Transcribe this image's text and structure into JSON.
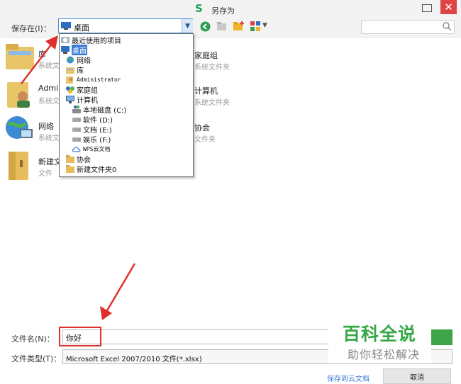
{
  "title": {
    "logo": "S",
    "text": "另存为"
  },
  "toolbar": {
    "save_in_label": "保存在(I)：",
    "location_value": "桌面"
  },
  "files": [
    {
      "name": "库",
      "type": "系统文件夹",
      "icon": "library-folder-icon"
    },
    {
      "name": "家庭组",
      "type": "系统文件夹",
      "icon": "homegroup-icon"
    },
    {
      "name": "Admi",
      "type": "系统文",
      "icon": "user-folder-icon"
    },
    {
      "name": "计算机",
      "type": "系统文件夹",
      "icon": "computer-icon"
    },
    {
      "name": "网络",
      "type": "系统文",
      "icon": "network-globe-icon"
    },
    {
      "name": "协会",
      "type": "文件夹",
      "icon": "folder-icon"
    },
    {
      "name": "新建文",
      "type": "文件",
      "icon": "folder-icon"
    }
  ],
  "dropdown": {
    "items": [
      {
        "label": "最近使用的项目",
        "icon": "recent-items-icon"
      },
      {
        "label": "桌面",
        "icon": "desktop-icon",
        "selected": true
      },
      {
        "label": "网络",
        "icon": "network-icon"
      },
      {
        "label": "库",
        "icon": "library-icon"
      },
      {
        "label": "Administrator",
        "icon": "user-icon"
      },
      {
        "label": "家庭组",
        "icon": "homegroup-icon"
      },
      {
        "label": "计算机",
        "icon": "computer-icon"
      },
      {
        "label": "本地磁盘 (C:)",
        "icon": "local-disk-icon"
      },
      {
        "label": "软件 (D:)",
        "icon": "drive-icon"
      },
      {
        "label": "文档 (E:)",
        "icon": "drive-icon"
      },
      {
        "label": "娱乐 (F:)",
        "icon": "drive-icon"
      },
      {
        "label": "WPS云文档",
        "icon": "cloud-icon"
      },
      {
        "label": "协会",
        "icon": "folder-icon"
      },
      {
        "label": "新建文件夹0",
        "icon": "folder-icon"
      }
    ]
  },
  "bottom": {
    "filename_label": "文件名(N)：",
    "filename_value": "你好",
    "filetype_label": "文件类型(T)：",
    "filetype_value": "Microsoft Excel 2007/2010 文件(*.xlsx)",
    "cloud_link": "保存到云文档",
    "cancel_label": "取消"
  },
  "watermark": {
    "title": "百科全说",
    "subtitle": "助你轻松解决"
  },
  "colors": {
    "accent": "#3a7bd5",
    "wps_green": "#18a058",
    "close_red": "#e04343",
    "annotation_red": "#e0302c"
  }
}
